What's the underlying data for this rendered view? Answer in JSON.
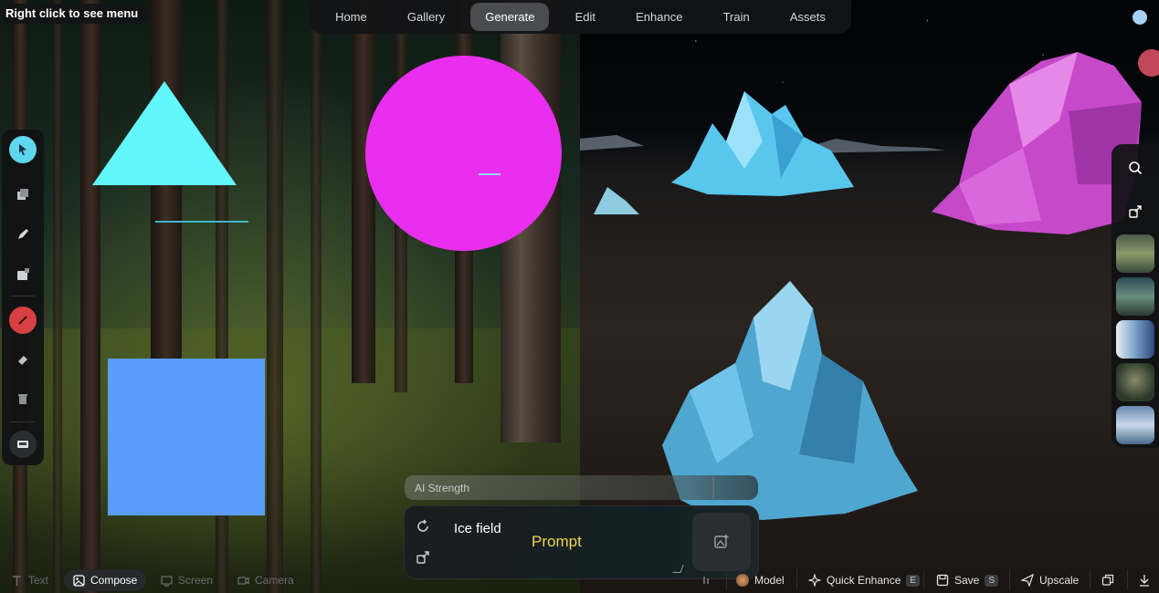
{
  "tooltip": "Right click to see menu",
  "nav": {
    "tabs": [
      {
        "label": "Home"
      },
      {
        "label": "Gallery"
      },
      {
        "label": "Generate",
        "active": true
      },
      {
        "label": "Edit"
      },
      {
        "label": "Enhance"
      },
      {
        "label": "Train"
      },
      {
        "label": "Assets"
      }
    ]
  },
  "left_toolbar": {
    "tools": [
      "select-icon",
      "layers-icon",
      "pen-icon",
      "image-add-icon",
      "brush-icon",
      "eraser-icon",
      "trash-icon",
      "canvas-icon"
    ]
  },
  "right_toolbar": {
    "icons": [
      "search-icon",
      "share-icon"
    ],
    "thumbnails": 5
  },
  "ai_strength": {
    "label": "AI Strength",
    "value": 0.87
  },
  "prompt": {
    "value": "Ice field",
    "placeholder": "Prompt"
  },
  "bottom_bar": {
    "modes": [
      {
        "label": "Text"
      },
      {
        "label": "Compose",
        "active": true
      },
      {
        "label": "Screen"
      },
      {
        "label": "Camera"
      }
    ],
    "actions": {
      "model_label": "Model",
      "quick_enhance_label": "Quick Enhance",
      "quick_enhance_key": "E",
      "save_label": "Save",
      "save_key": "S",
      "upscale_label": "Upscale"
    }
  },
  "colors": {
    "triangle": "#62f6fd",
    "circle": "#ea2ef0",
    "square": "#5a9dfb",
    "prompt_placeholder": "#f1d64f",
    "select_tool": "#5ed7ee",
    "brush_tool": "#d84141"
  }
}
